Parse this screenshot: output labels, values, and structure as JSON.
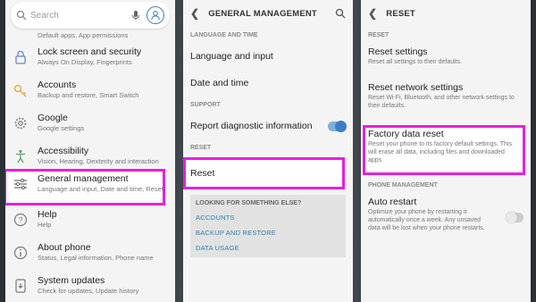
{
  "settings": {
    "search_placeholder": "Search",
    "partial_item_sub": "Default apps, App permissions",
    "items": [
      {
        "label": "Lock screen and security",
        "sub": "Always On Display, Fingerprints"
      },
      {
        "label": "Accounts",
        "sub": "Backup and restore, Smart Switch"
      },
      {
        "label": "Google",
        "sub": "Google settings"
      },
      {
        "label": "Accessibility",
        "sub": "Vision, Hearing, Dexterity and interaction"
      },
      {
        "label": "General management",
        "sub": "Language and input, Date and time, Reset"
      },
      {
        "label": "Help",
        "sub": "Help"
      },
      {
        "label": "About phone",
        "sub": "Status, Legal information, Phone name"
      },
      {
        "label": "System updates",
        "sub": "Check for updates, Update history"
      }
    ]
  },
  "general": {
    "title": "GENERAL MANAGEMENT",
    "section_lang": "LANGUAGE AND TIME",
    "lang_input": "Language and input",
    "date_time": "Date and time",
    "section_support": "SUPPORT",
    "report_diag": "Report diagnostic information",
    "report_diag_on": true,
    "section_reset": "RESET",
    "reset": "Reset",
    "looking_title": "LOOKING FOR SOMETHING ELSE?",
    "links": [
      "ACCOUNTS",
      "BACKUP AND RESTORE",
      "DATA USAGE"
    ]
  },
  "reset_panel": {
    "title": "RESET",
    "section_reset": "RESET",
    "reset_settings": "Reset settings",
    "reset_settings_sub": "Reset all settings to their defaults.",
    "reset_network": "Reset network settings",
    "reset_network_sub": "Reset Wi-Fi, Bluetooth, and other network settings to their defaults.",
    "factory": "Factory data reset",
    "factory_sub": "Reset your phone to its factory default settings. This will erase all data, including files and downloaded apps.",
    "section_phone": "PHONE MANAGEMENT",
    "auto_restart": "Auto restart",
    "auto_restart_sub": "Optimize your phone by restarting it automatically once a week. Any unsaved data will be lost when your phone restarts.",
    "auto_restart_on": false
  },
  "colors": {
    "highlight": "#e620dc",
    "link": "#2a7fb0",
    "toggle_on": "#3d7dc7"
  }
}
